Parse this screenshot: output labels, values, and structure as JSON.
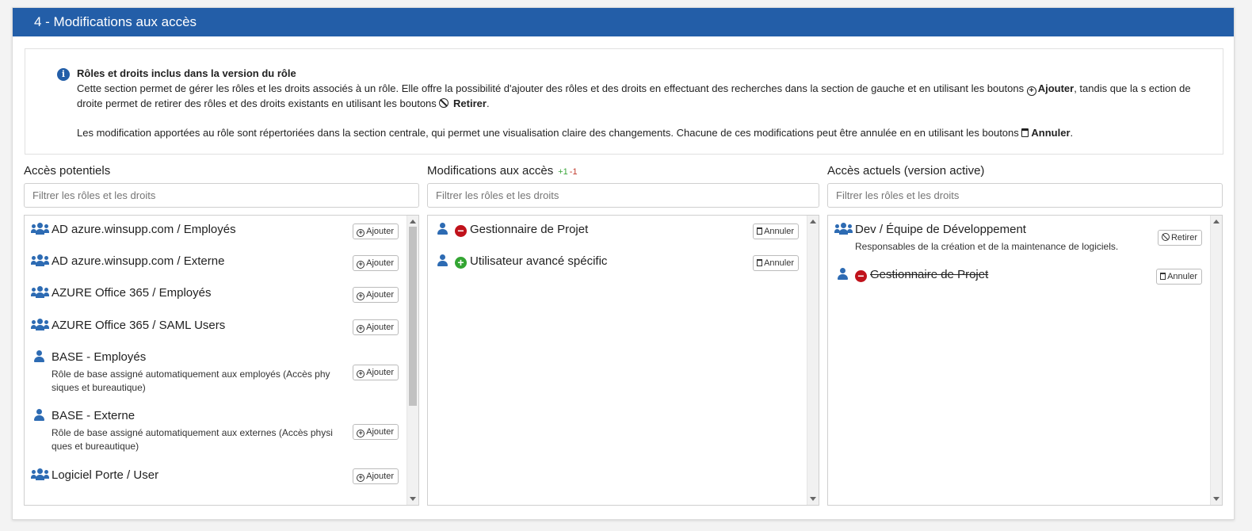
{
  "section_title": "4 - Modifications aux accès",
  "info": {
    "title": "Rôles et droits inclus dans la version du rôle",
    "p1_a": "Cette section permet de gérer les rôles et les droits associés à un rôle. Elle offre la possibilité d'ajouter des rôles et des droits en effectuant des recherches dans la section de gauche et en utilisant les boutons ",
    "p1_add": "Ajouter",
    "p1_b": ", tandis que la s ection de droite permet de retirer des rôles et des droits existants en utilisant les boutons ",
    "p1_remove": "Retirer",
    "p1_end": ".",
    "p2_a": "Les modification apportées au rôle sont répertoriées dans la section centrale, qui permet une visualisation claire des changements. Chacune de ces modifications peut être annulée en en utilisant les boutons ",
    "p2_cancel": "Annuler",
    "p2_end": "."
  },
  "potential": {
    "title": "Accès potentiels",
    "filter_placeholder": "Filtrer les rôles et les droits",
    "button_label": "Ajouter",
    "items": [
      {
        "name": "AD azure.winsupp.com / Employés",
        "icon": "group-icon"
      },
      {
        "name": "AD azure.winsupp.com / Externe",
        "icon": "group-icon"
      },
      {
        "name": "AZURE Office 365 / Employés",
        "icon": "group-icon"
      },
      {
        "name": "AZURE Office 365 / SAML Users",
        "icon": "group-icon"
      },
      {
        "name": "BASE - Employés",
        "icon": "user-icon",
        "desc": "Rôle de base assigné automatiquement aux employés (Accès phy siques et bureautique)"
      },
      {
        "name": "BASE - Externe",
        "icon": "user-icon",
        "desc": "Rôle de base assigné automatiquement aux externes (Accès physi ques et bureautique)"
      },
      {
        "name": "Logiciel Porte / User",
        "icon": "group-icon"
      }
    ]
  },
  "modifications": {
    "title": "Modifications aux accès",
    "added_count": "+1",
    "removed_count": "-1",
    "filter_placeholder": "Filtrer les rôles et les droits",
    "button_label": "Annuler",
    "items": [
      {
        "name": "Gestionnaire de Projet",
        "change": "removed",
        "icon": "user-icon"
      },
      {
        "name": "Utilisateur avancé spécific",
        "change": "added",
        "icon": "user-icon"
      }
    ]
  },
  "current": {
    "title": "Accès actuels (version active)",
    "filter_placeholder": "Filtrer les rôles et les droits",
    "items": [
      {
        "name": "Dev / Équipe de Développement",
        "desc": "Responsables de la création et de la maintenance de logiciels.",
        "button": "Retirer",
        "icon": "group-icon"
      },
      {
        "name": "Gestionnaire de Projet",
        "button": "Annuler",
        "change": "removed",
        "icon": "user-icon"
      }
    ]
  },
  "colors": {
    "header": "#235ea8",
    "icon": "#2d6bb3",
    "added": "#33a532",
    "removed": "#c0121b"
  }
}
